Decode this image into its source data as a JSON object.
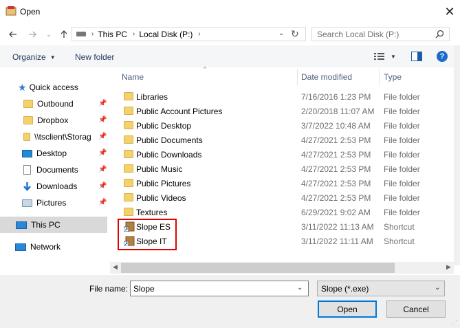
{
  "window": {
    "title": "Open"
  },
  "address": {
    "crumbs": [
      "This PC",
      "Local Disk (P:)"
    ]
  },
  "search": {
    "placeholder": "Search Local Disk (P:)"
  },
  "toolbar": {
    "organize": "Organize",
    "new_folder": "New folder"
  },
  "sidebar": {
    "quick_access": "Quick access",
    "items": [
      {
        "label": "Outbound",
        "icon": "folder-icon"
      },
      {
        "label": "Dropbox",
        "icon": "folder-icon"
      },
      {
        "label": "\\\\tsclient\\Storag",
        "icon": "folder-icon"
      },
      {
        "label": "Desktop",
        "icon": "desktop-icon"
      },
      {
        "label": "Documents",
        "icon": "documents-icon"
      },
      {
        "label": "Downloads",
        "icon": "downloads-icon"
      },
      {
        "label": "Pictures",
        "icon": "pictures-icon"
      }
    ],
    "this_pc": "This PC",
    "network": "Network"
  },
  "columns": {
    "name": "Name",
    "date": "Date modified",
    "type": "Type"
  },
  "files": [
    {
      "name": "Libraries",
      "date": "7/16/2016 1:23 PM",
      "type": "File folder",
      "icon": "folder-icon"
    },
    {
      "name": "Public Account Pictures",
      "date": "2/20/2018 11:07 AM",
      "type": "File folder",
      "icon": "folder-icon"
    },
    {
      "name": "Public Desktop",
      "date": "3/7/2022 10:48 AM",
      "type": "File folder",
      "icon": "folder-icon"
    },
    {
      "name": "Public Documents",
      "date": "4/27/2021 2:53 PM",
      "type": "File folder",
      "icon": "folder-icon"
    },
    {
      "name": "Public Downloads",
      "date": "4/27/2021 2:53 PM",
      "type": "File folder",
      "icon": "folder-icon"
    },
    {
      "name": "Public Music",
      "date": "4/27/2021 2:53 PM",
      "type": "File folder",
      "icon": "folder-icon"
    },
    {
      "name": "Public Pictures",
      "date": "4/27/2021 2:53 PM",
      "type": "File folder",
      "icon": "folder-icon"
    },
    {
      "name": "Public Videos",
      "date": "4/27/2021 2:53 PM",
      "type": "File folder",
      "icon": "folder-icon"
    },
    {
      "name": "Textures",
      "date": "6/29/2021 9:02 AM",
      "type": "File folder",
      "icon": "folder-icon"
    },
    {
      "name": "Slope ES",
      "date": "3/11/2022 11:13 AM",
      "type": "Shortcut",
      "icon": "shortcut-icon"
    },
    {
      "name": "Slope IT",
      "date": "3/11/2022 11:11 AM",
      "type": "Shortcut",
      "icon": "shortcut-icon"
    }
  ],
  "bottom": {
    "file_name_label": "File name:",
    "file_name_value": "Slope",
    "filter_value": "Slope (*.exe)",
    "open": "Open",
    "cancel": "Cancel"
  },
  "colors": {
    "highlight": "#e00000",
    "accent": "#0078d7"
  }
}
